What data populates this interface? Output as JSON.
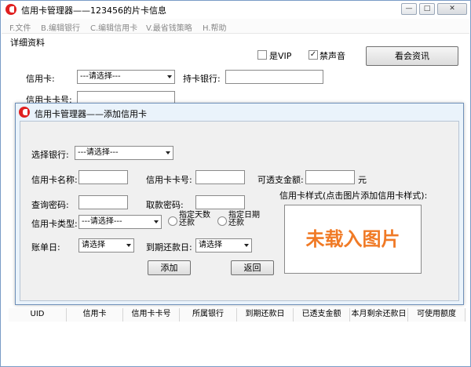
{
  "window": {
    "title": "信用卡管理器——123456的片卡信息",
    "controls": {
      "minimize": "—",
      "maximize": "□",
      "close": "✕"
    }
  },
  "menu": [
    {
      "label": "F.文件"
    },
    {
      "label": "B.编辑银行"
    },
    {
      "label": "C.编辑信用卡"
    },
    {
      "label": "V.最省钱策略"
    },
    {
      "label": "H.帮助"
    }
  ],
  "details": {
    "group_label": "详细资料",
    "vip_label": "是VIP",
    "vip_checked": false,
    "mute_label": "禁声音",
    "mute_checked": true,
    "news_button": "看会资讯",
    "card_label": "信用卡:",
    "card_select": "---请选择---",
    "bank_label": "持卡银行:",
    "cardno_label": "信用卡卡号:"
  },
  "dialog": {
    "title": "信用卡管理器——添加信用卡",
    "select_bank_label": "选择银行:",
    "select_bank_value": "---请选择---",
    "card_name_label": "信用卡名称:",
    "card_no_label": "信用卡卡号:",
    "overdraft_label": "可透支金额:",
    "yuan": "元",
    "query_pwd_label": "查询密码:",
    "withdraw_pwd_label": "取款密码:",
    "card_type_label": "信用卡类型:",
    "card_type_value": "---请选择---",
    "radio_days_line1": "指定天数",
    "radio_days_line2": "还款",
    "radio_date_line1": "指定日期",
    "radio_date_line2": "还款",
    "style_label": "信用卡样式(点击图片添加信用卡样式):",
    "bill_day_label": "账单日:",
    "bill_day_value": "请选择",
    "due_day_label": "到期还款日:",
    "due_day_value": "请选择",
    "image_placeholder": "未载入图片",
    "add_button": "添加",
    "back_button": "返回"
  },
  "table": {
    "columns": [
      "UID",
      "信用卡",
      "信用卡卡号",
      "所属银行",
      "到期还款日",
      "已透支金额",
      "本月剩余还款日",
      "可使用额度"
    ]
  },
  "colors": {
    "accent": "#e02020",
    "image_text": "#f07a26",
    "dialog_border": "#6e8fb8"
  }
}
